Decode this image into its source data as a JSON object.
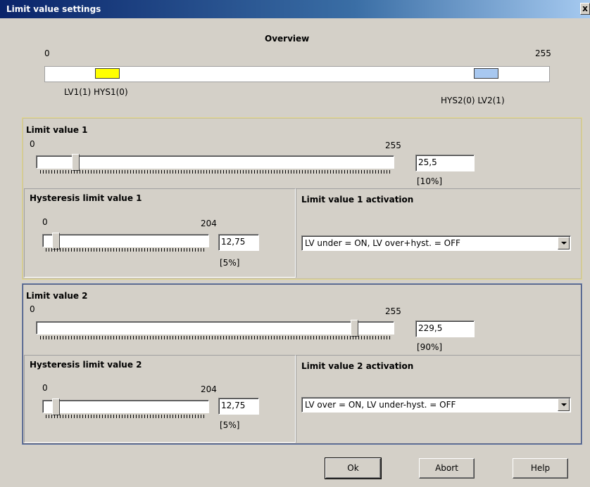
{
  "window": {
    "title": "Limit value settings",
    "close_label": "x"
  },
  "overview": {
    "heading": "Overview",
    "min_label": "0",
    "max_label": "255",
    "left_marker_label": "LV1(1) HYS1(0)",
    "right_marker_label": "HYS2(0) LV2(1)",
    "left_marker_color": "#ffff00",
    "right_marker_color": "#a8c8f0"
  },
  "lv1": {
    "heading": "Limit value 1",
    "min_label": "0",
    "max_label": "255",
    "value": "25,5",
    "percent": "[10%]",
    "slider_fraction": 0.1,
    "hysteresis": {
      "heading": "Hysteresis limit value 1",
      "min_label": "0",
      "max_label": "204",
      "value": "12,75",
      "percent": "[5%]",
      "slider_fraction": 0.0625
    },
    "activation": {
      "heading": "Limit value 1 activation",
      "selected": "LV under = ON, LV over+hyst. = OFF"
    }
  },
  "lv2": {
    "heading": "Limit value 2",
    "min_label": "0",
    "max_label": "255",
    "value": "229,5",
    "percent": "[90%]",
    "slider_fraction": 0.9,
    "hysteresis": {
      "heading": "Hysteresis limit value 2",
      "min_label": "0",
      "max_label": "204",
      "value": "12,75",
      "percent": "[5%]",
      "slider_fraction": 0.0625
    },
    "activation": {
      "heading": "Limit value 2 activation",
      "selected": "LV over = ON, LV under-hyst. = OFF"
    }
  },
  "buttons": {
    "ok": "Ok",
    "abort": "Abort",
    "help": "Help"
  }
}
